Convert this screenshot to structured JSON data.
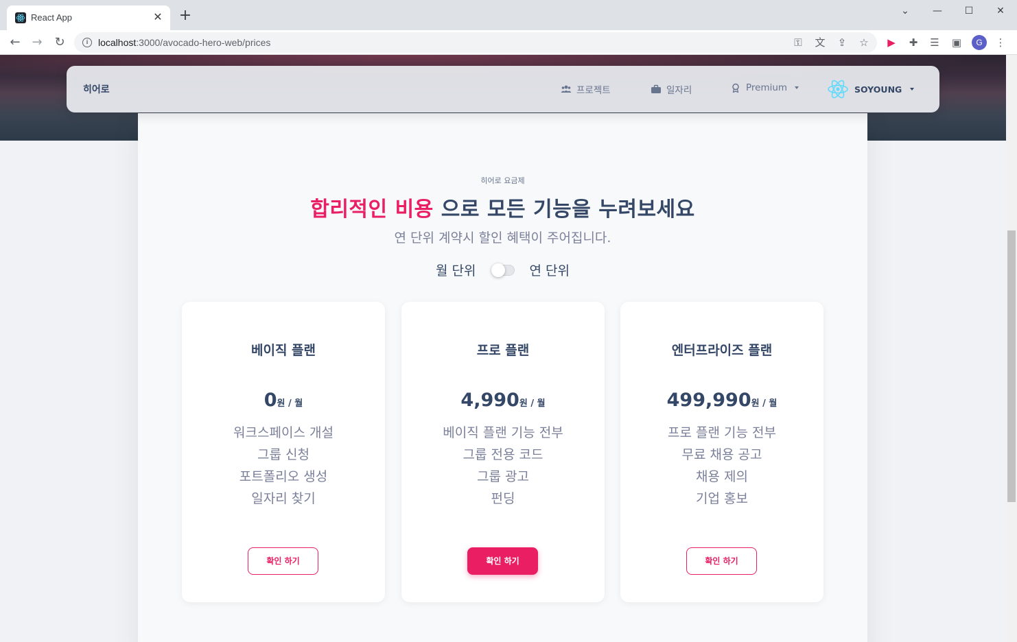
{
  "browser": {
    "tab_title": "React App",
    "url_host": "localhost",
    "url_path": ":3000/avocado-hero-web/prices",
    "profile_initial": "G"
  },
  "navbar": {
    "brand": "히어로",
    "items": [
      {
        "label": "프로젝트",
        "icon": "users-icon"
      },
      {
        "label": "일자리",
        "icon": "briefcase-icon"
      },
      {
        "label": "Premium",
        "icon": "badge-icon"
      }
    ],
    "user": "SOYOUNG"
  },
  "hero": {
    "eyebrow": "히어로 요금제",
    "headline_accent": "합리적인 비용",
    "headline_rest": " 으로 모든 기능을 누려보세요",
    "subline": "연 단위 계약시 할인 혜택이 주어집니다."
  },
  "billing_toggle": {
    "left_label": "월 단위",
    "right_label": "연 단위",
    "annual_selected": false
  },
  "plans": [
    {
      "name": "베이직 플랜",
      "price": "0",
      "unit": "원 / 월",
      "features": [
        "워크스페이스 개설",
        "그룹 신청",
        "포트폴리오 생성",
        "일자리 찾기"
      ],
      "button": "확인 하기",
      "highlighted": false
    },
    {
      "name": "프로 플랜",
      "price": "4,990",
      "unit": "원 / 월",
      "features": [
        "베이직 플랜 기능 전부",
        "그룹 전용 코드",
        "그룹 광고",
        "펀딩"
      ],
      "button": "확인 하기",
      "highlighted": true
    },
    {
      "name": "엔터프라이즈 플랜",
      "price": "499,990",
      "unit": "원 / 월",
      "features": [
        "프로 플랜 기능 전부",
        "무료 채용 공고",
        "채용 제의",
        "기업 홍보"
      ],
      "button": "확인 하기",
      "highlighted": false
    }
  ],
  "colors": {
    "accent": "#e91e63",
    "text_dark": "#344767",
    "text_muted": "#7b809a"
  }
}
